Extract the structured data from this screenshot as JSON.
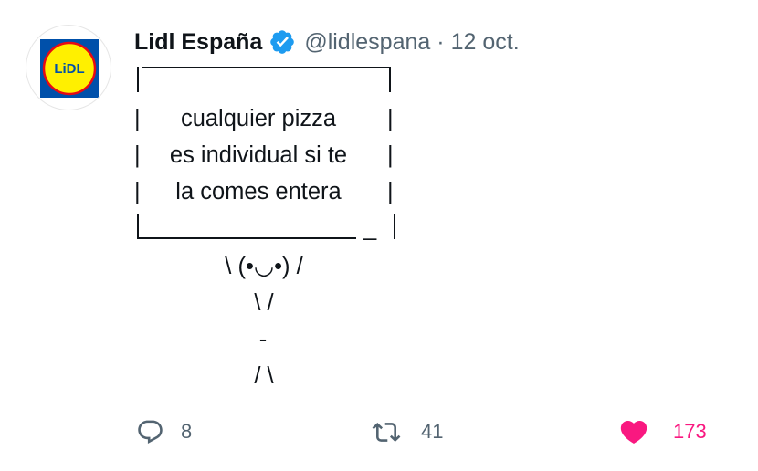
{
  "tweet": {
    "author_name": "Lidl España",
    "handle": "@lidlespana",
    "separator": "·",
    "date": "12 oct.",
    "avatar_text": "LiDL",
    "verified_icon": "verified-badge-icon",
    "ascii_art": {
      "left_bar_top": "|",
      "right_bar_top": "|",
      "line1": "cualquier pizza",
      "line2": "es individual si te",
      "line3": "la comes entera",
      "left_bar": "|",
      "right_bar": "|",
      "bottom_underscore": "_",
      "figure_face": "\\ (•◡•) /",
      "figure_arms": "\\ /",
      "figure_waist": "-",
      "figure_legs": "/ \\"
    }
  },
  "actions": {
    "reply": {
      "icon": "reply-icon",
      "count": "8"
    },
    "retweet": {
      "icon": "retweet-icon",
      "count": "41"
    },
    "like": {
      "icon": "heart-icon",
      "count": "173"
    }
  },
  "colors": {
    "text": "#0f1419",
    "secondary": "#536471",
    "verified": "#1d9bf0",
    "like": "#f91880",
    "lidl_blue": "#0050aa",
    "lidl_yellow": "#fff000",
    "lidl_red": "#e60a14"
  }
}
